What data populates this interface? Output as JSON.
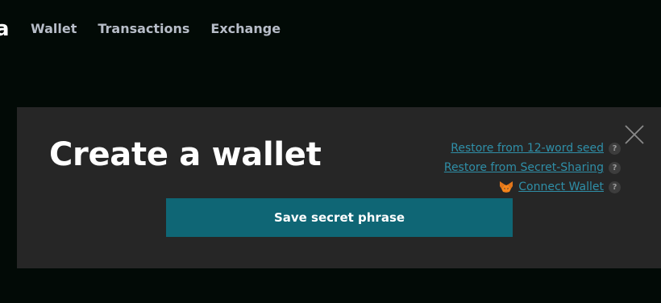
{
  "header": {
    "logo_fragment": "a",
    "nav": [
      {
        "label": "Wallet"
      },
      {
        "label": "Transactions"
      },
      {
        "label": "Exchange"
      }
    ]
  },
  "modal": {
    "title": "Create a wallet",
    "options": [
      {
        "label": "Restore from 12-word seed",
        "icon": "question-mark-icon"
      },
      {
        "label": "Restore from Secret-Sharing",
        "icon": "question-mark-icon"
      },
      {
        "label": "Connect Wallet",
        "icon": "question-mark-icon",
        "leading_icon": "metamask-fox-icon"
      }
    ],
    "help_glyph": "?",
    "primary_button": "Save secret phrase",
    "close_icon": "close-icon"
  },
  "colors": {
    "page_background": "#020a06",
    "modal_background": "#262626",
    "link": "#2f8fa8",
    "primary_button": "#0f6675",
    "nav_text": "#b7bdc8"
  }
}
